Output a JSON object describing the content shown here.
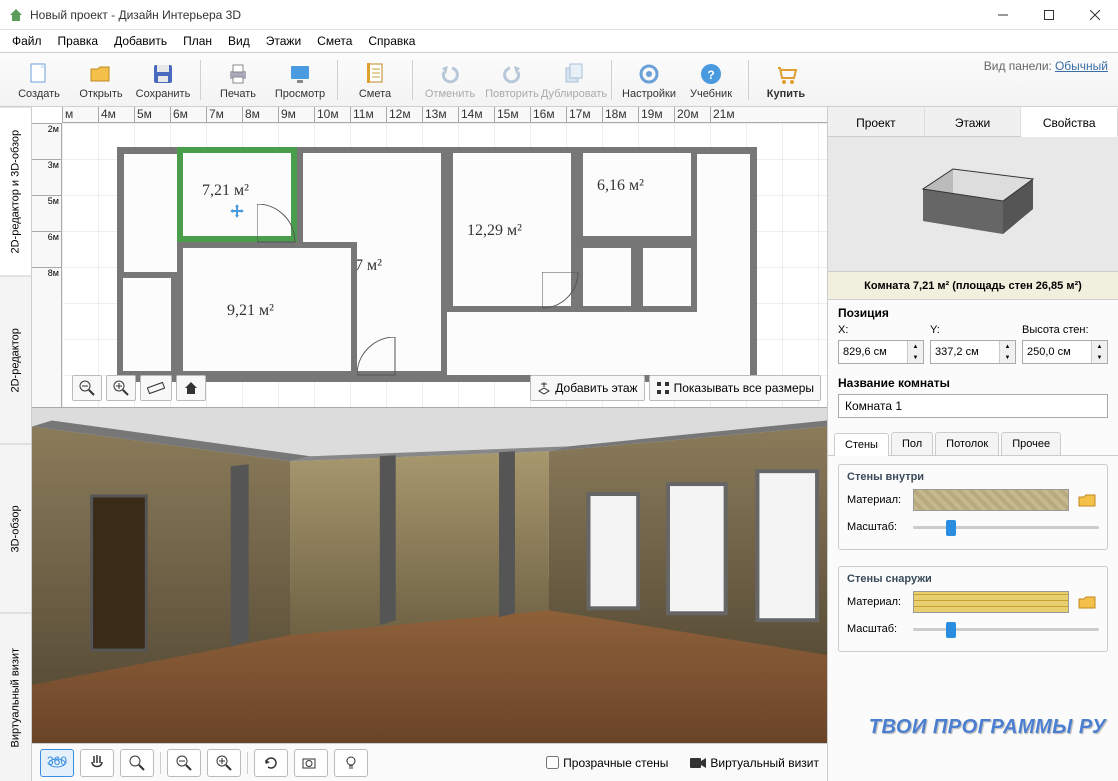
{
  "title": "Новый проект - Дизайн Интерьера 3D",
  "menubar": [
    "Файл",
    "Правка",
    "Добавить",
    "План",
    "Вид",
    "Этажи",
    "Смета",
    "Справка"
  ],
  "toolbar": {
    "create": "Создать",
    "open": "Открыть",
    "save": "Сохранить",
    "print": "Печать",
    "preview": "Просмотр",
    "estimate": "Смета",
    "undo": "Отменить",
    "redo": "Повторить",
    "duplicate": "Дублировать",
    "settings": "Настройки",
    "tutorial": "Учебник",
    "buy": "Купить",
    "panelview_label": "Вид панели:",
    "panelview_value": "Обычный"
  },
  "lefttabs": {
    "combo": "2D-редактор и 3D-обзор",
    "edit2d": "2D-редактор",
    "view3d": "3D-обзор",
    "tour": "Виртуальный визит"
  },
  "ruler_h": [
    "м",
    "4м",
    "5м",
    "6м",
    "7м",
    "8м",
    "9м",
    "10м",
    "11м",
    "12м",
    "13м",
    "14м",
    "15м",
    "16м",
    "17м",
    "18м",
    "19м",
    "20м",
    "21м"
  ],
  "ruler_v": [
    "2м",
    "3м",
    "5м",
    "6м",
    "8м"
  ],
  "rooms": {
    "r1": "7,21 м²",
    "r2": "18,67 м²",
    "r3": "12,29 м²",
    "r4": "6,16 м²",
    "r5": "9,21 м²"
  },
  "plan_controls": {
    "add_floor": "Добавить этаж",
    "show_all": "Показывать все размеры"
  },
  "bottombar": {
    "transparent": "Прозрачные стены",
    "tour": "Виртуальный визит"
  },
  "right": {
    "tabs": {
      "project": "Проект",
      "floors": "Этажи",
      "props": "Свойства"
    },
    "roominfo": "Комната 7,21 м²  (площадь стен 26,85 м²)",
    "position": {
      "title": "Позиция",
      "x_label": "X:",
      "y_label": "Y:",
      "h_label": "Высота стен:",
      "x": "829,6 см",
      "y": "337,2 см",
      "h": "250,0 см"
    },
    "name": {
      "title": "Название комнаты",
      "value": "Комната 1"
    },
    "subtabs": {
      "walls": "Стены",
      "floor": "Пол",
      "ceiling": "Потолок",
      "other": "Прочее"
    },
    "walls_in": {
      "title": "Стены внутри",
      "material": "Материал:",
      "scale": "Масштаб:"
    },
    "walls_out": {
      "title": "Стены снаружи",
      "material": "Материал:",
      "scale": "Масштаб:"
    }
  },
  "watermark": "ТВОИ ПРОГРАММЫ РУ"
}
